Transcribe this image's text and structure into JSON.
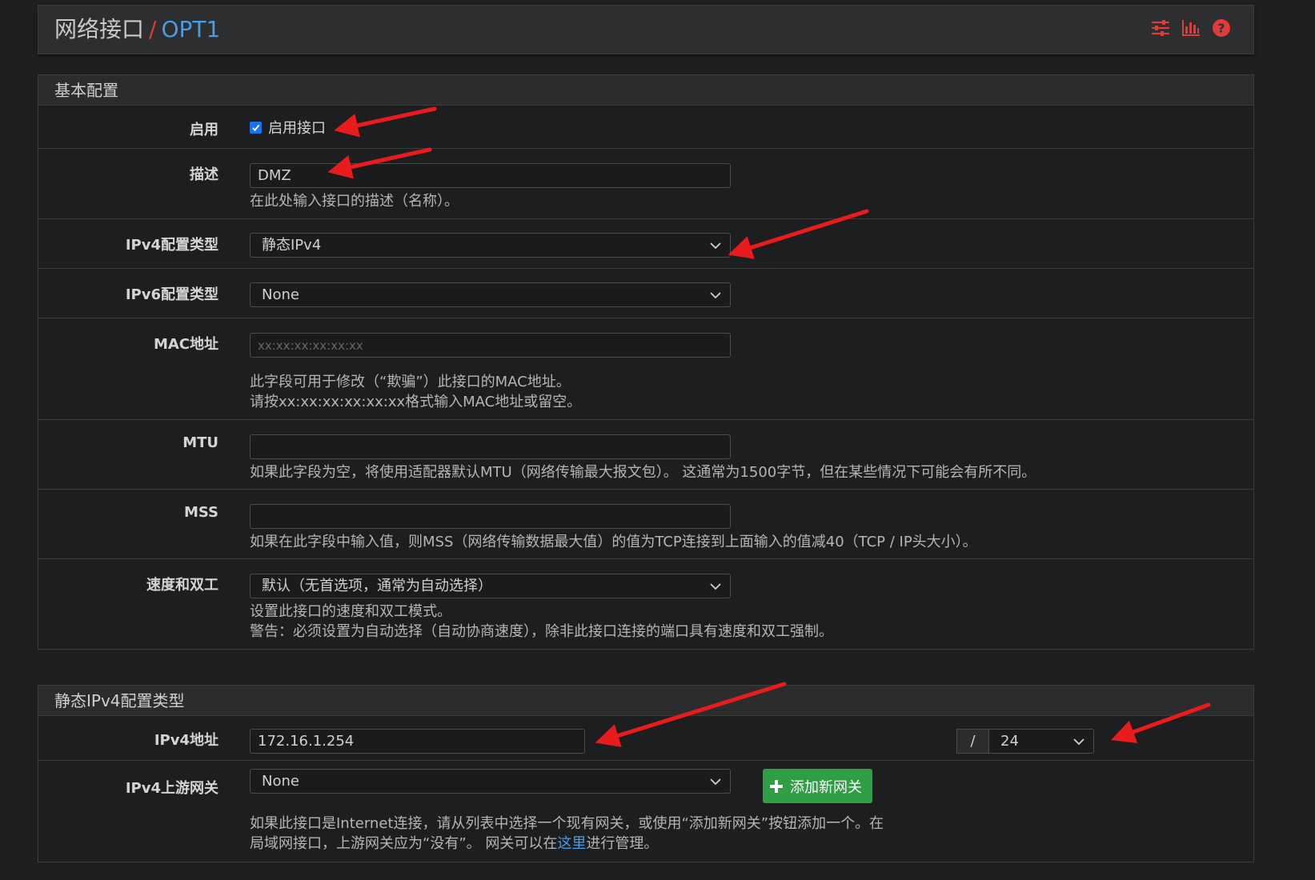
{
  "breadcrumb": {
    "root": "网络接口",
    "separator": "/",
    "current": "OPT1"
  },
  "top_icons": [
    "sliders-icon",
    "bar-chart-icon",
    "help-icon"
  ],
  "colors": {
    "accent": "#4a9de3",
    "separator": "#e03a3a",
    "icon_red": "#e03a3a",
    "checkbox": "#1a73e8",
    "button_green": "#2f9e44",
    "arrow": "#e81c1c"
  },
  "basic": {
    "title": "基本配置",
    "enable": {
      "label": "启用",
      "checkbox_label": "启用接口",
      "checked": true
    },
    "description": {
      "label": "描述",
      "value": "DMZ",
      "help": "在此处输入接口的描述（名称）。"
    },
    "ipv4_type": {
      "label": "IPv4配置类型",
      "value": "静态IPv4"
    },
    "ipv6_type": {
      "label": "IPv6配置类型",
      "value": "None"
    },
    "mac": {
      "label": "MAC地址",
      "placeholder": "xx:xx:xx:xx:xx:xx",
      "help1": "此字段可用于修改（“欺骗”）此接口的MAC地址。",
      "help2": "请按xx:xx:xx:xx:xx:xx格式输入MAC地址或留空。"
    },
    "mtu": {
      "label": "MTU",
      "value": "",
      "help": "如果此字段为空，将使用适配器默认MTU（网络传输最大报文包）。 这通常为1500字节，但在某些情况下可能会有所不同。"
    },
    "mss": {
      "label": "MSS",
      "value": "",
      "help": "如果在此字段中输入值，则MSS（网络传输数据最大值）的值为TCP连接到上面输入的值减40（TCP / IP头大小）。"
    },
    "speed": {
      "label": "速度和双工",
      "value": "默认（无首选项，通常为自动选择）",
      "help1": "设置此接口的速度和双工模式。",
      "help2": "警告：必须设置为自动选择（自动协商速度），除非此接口连接的端口具有速度和双工强制。"
    }
  },
  "static_ipv4": {
    "title": "静态IPv4配置类型",
    "address": {
      "label": "IPv4地址",
      "value": "172.16.1.254",
      "slash": "/",
      "cidr": "24"
    },
    "gateway": {
      "label": "IPv4上游网关",
      "value": "None",
      "button": "添加新网关",
      "help1": "如果此接口是Internet连接，请从列表中选择一个现有网关，或使用“添加新网关”按钮添加一个。在",
      "help2_pre": "局域网接口，上游网关应为“没有”。 网关可以在",
      "help2_link": "这里",
      "help2_post": "进行管理。"
    }
  }
}
